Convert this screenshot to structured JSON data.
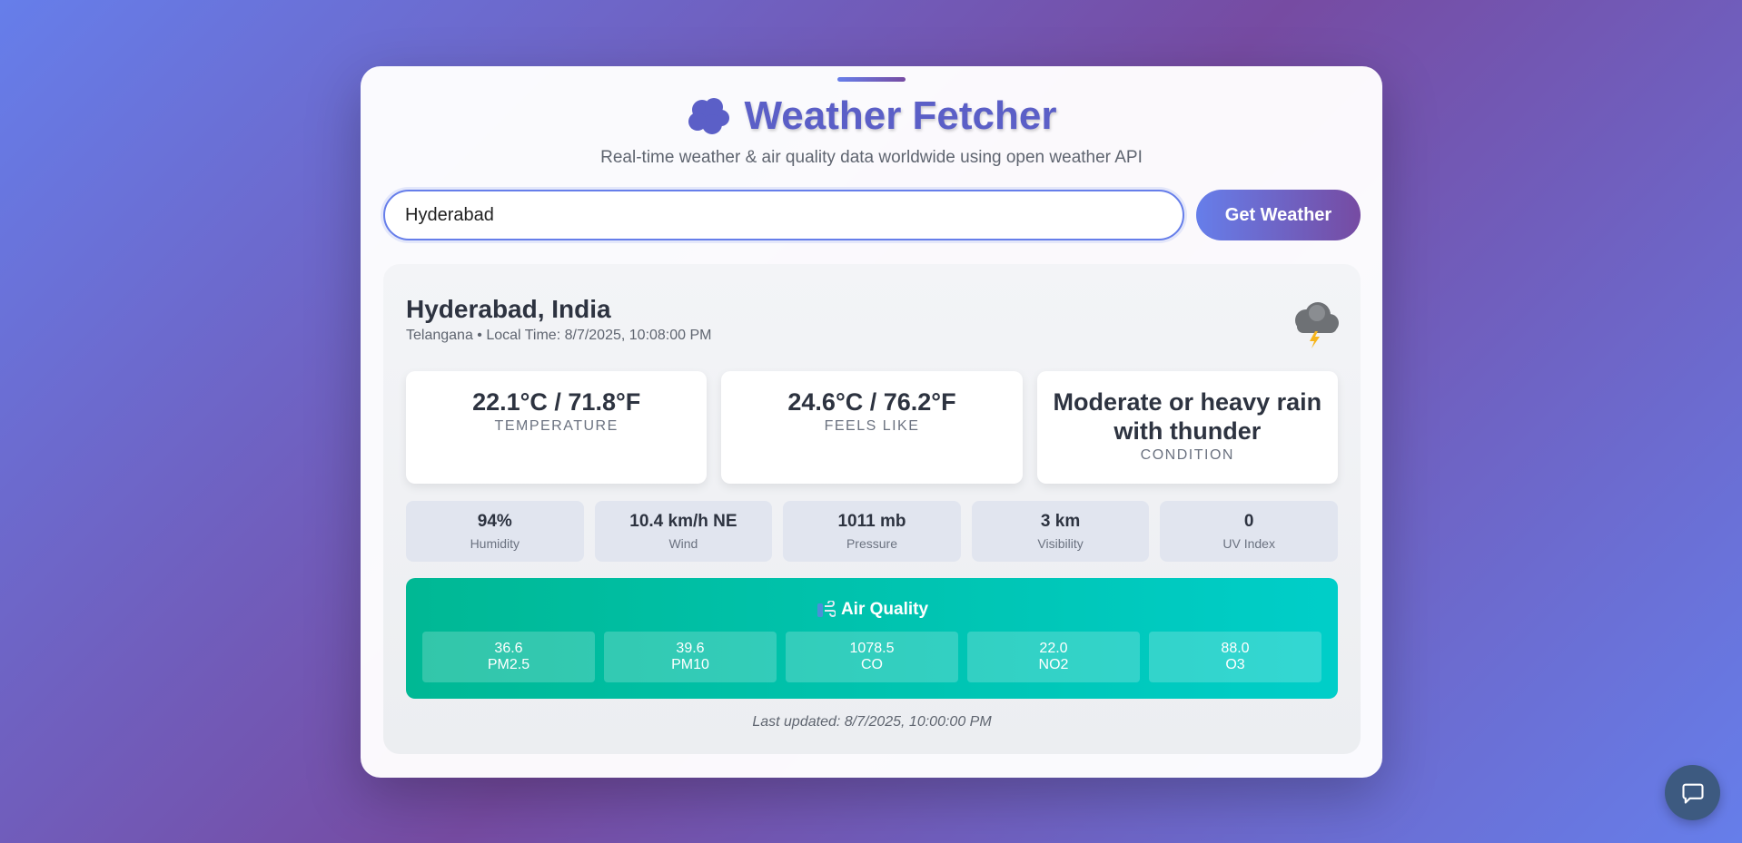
{
  "app": {
    "title": "Weather Fetcher",
    "subtitle": "Real-time weather & air quality data worldwide using open weather API",
    "title_icon": "cloud-icon"
  },
  "search": {
    "value": "Hyderabad",
    "button_label": "Get Weather"
  },
  "location": {
    "name": "Hyderabad, India",
    "meta": "Telangana • Local Time: 8/7/2025, 10:08:00 PM",
    "weather_icon": "thunder-cloud-icon"
  },
  "main": [
    {
      "value": "22.1°C / 71.8°F",
      "label": "TEMPERATURE"
    },
    {
      "value": "24.6°C / 76.2°F",
      "label": "FEELS LIKE"
    },
    {
      "value": "Moderate or heavy rain with thunder",
      "label": "CONDITION"
    }
  ],
  "stats": [
    {
      "value": "94%",
      "label": "Humidity"
    },
    {
      "value": "10.4 km/h NE",
      "label": "Wind"
    },
    {
      "value": "1011 mb",
      "label": "Pressure"
    },
    {
      "value": "3 km",
      "label": "Visibility"
    },
    {
      "value": "0",
      "label": "UV Index"
    }
  ],
  "air_quality": {
    "title": "Air Quality",
    "icon": "wind-icon",
    "items": [
      {
        "value": "36.6",
        "label": "PM2.5"
      },
      {
        "value": "39.6",
        "label": "PM10"
      },
      {
        "value": "1078.5",
        "label": "CO"
      },
      {
        "value": "22.0",
        "label": "NO2"
      },
      {
        "value": "88.0",
        "label": "O3"
      }
    ]
  },
  "last_updated": "Last updated: 8/7/2025, 10:00:00 PM",
  "colors": {
    "accent_start": "#667eea",
    "accent_end": "#764ba2",
    "air_quality_start": "#00b894",
    "air_quality_end": "#00cec9"
  }
}
